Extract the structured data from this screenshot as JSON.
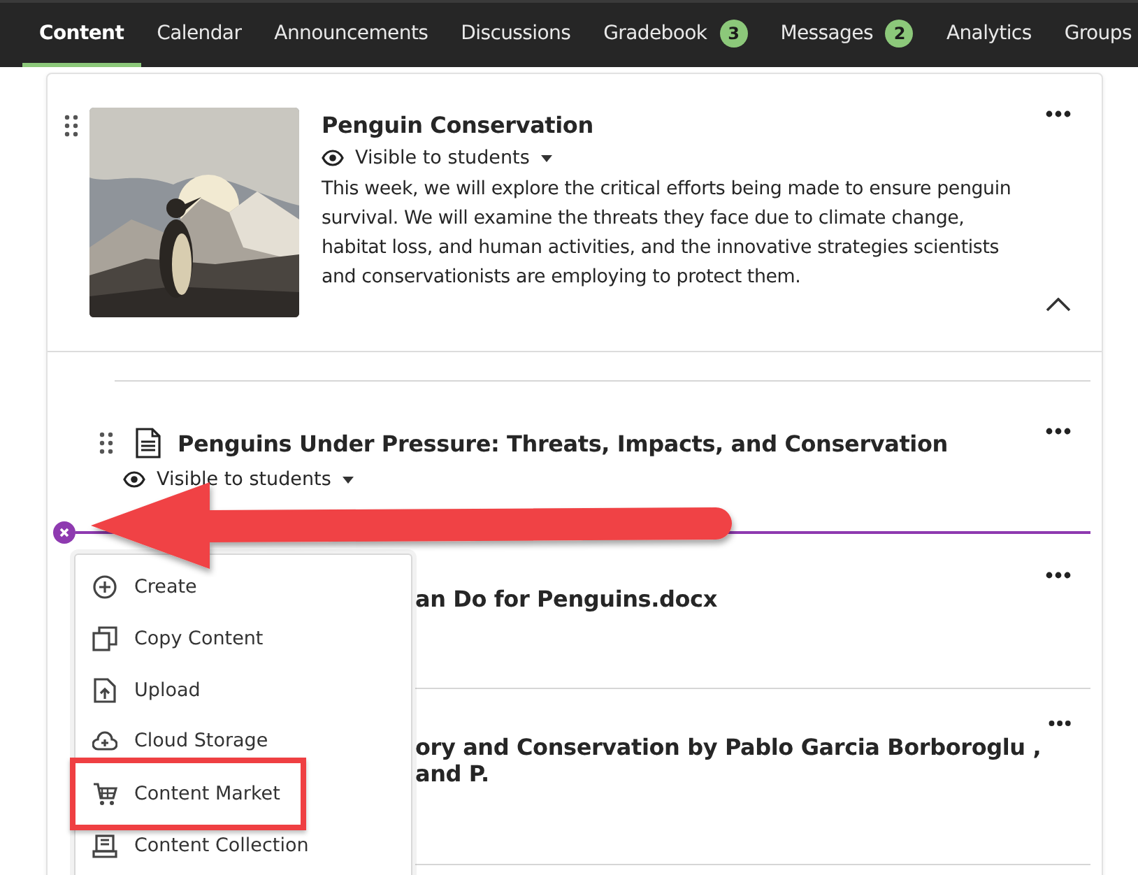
{
  "nav": {
    "tabs": [
      {
        "label": "Content",
        "selected": true
      },
      {
        "label": "Calendar",
        "selected": false
      },
      {
        "label": "Announcements",
        "selected": false
      },
      {
        "label": "Discussions",
        "selected": false
      },
      {
        "label": "Gradebook",
        "selected": false,
        "badge": "3"
      },
      {
        "label": "Messages",
        "selected": false,
        "badge": "2"
      },
      {
        "label": "Analytics",
        "selected": false
      },
      {
        "label": "Groups",
        "selected": false
      }
    ]
  },
  "module": {
    "title": "Penguin Conservation",
    "visibility": "Visible to students",
    "description": "This week, we will explore the critical efforts being made to ensure penguin survival. We will examine the threats they face due to climate change, habitat loss, and human activities, and the innovative strategies scientists and conservationists are employing to protect them.",
    "expanded": true
  },
  "items": [
    {
      "kind": "document",
      "title": "Penguins Under Pressure: Threats, Impacts, and Conservation",
      "visibility": "Visible to students"
    }
  ],
  "covered_items": [
    {
      "title": "an Do for Penguins.docx"
    },
    {
      "title": "ory and Conservation by Pablo Garcia Borboroglu , and P."
    }
  ],
  "add_menu": {
    "items": [
      {
        "kind": "create",
        "label": "Create",
        "highlighted": false
      },
      {
        "kind": "copy",
        "label": "Copy Content",
        "highlighted": false
      },
      {
        "kind": "upload",
        "label": "Upload",
        "highlighted": false
      },
      {
        "kind": "cloud",
        "label": "Cloud Storage",
        "highlighted": false
      },
      {
        "kind": "market",
        "label": "Content Market",
        "highlighted": true
      },
      {
        "kind": "collection",
        "label": "Content Collection",
        "highlighted": false
      }
    ]
  }
}
